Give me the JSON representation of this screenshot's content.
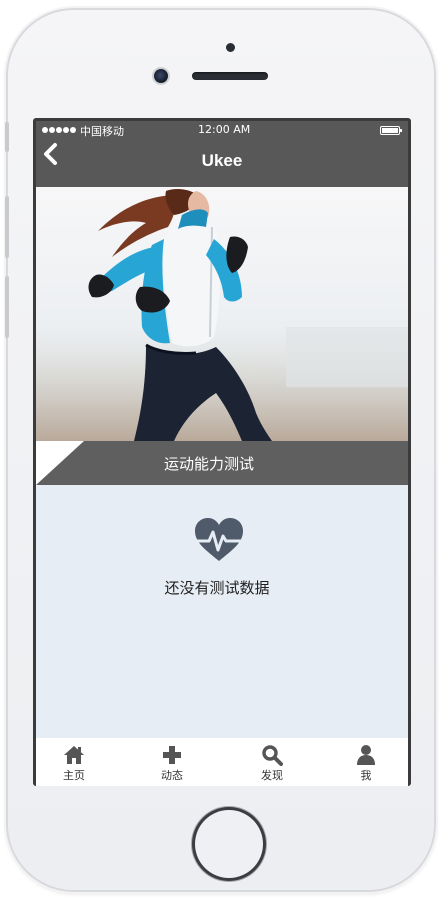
{
  "status_bar": {
    "carrier": "中国移动",
    "time": "12:00 AM"
  },
  "header": {
    "back_icon": "chevron-left-icon",
    "title": "Ukee"
  },
  "hero": {
    "image": "woman-running-photo"
  },
  "section": {
    "title": "运动能力测试"
  },
  "empty_state": {
    "icon": "heart-pulse-icon",
    "message": "还没有测试数据"
  },
  "tabbar": {
    "items": [
      {
        "label": "主页",
        "icon": "home-icon"
      },
      {
        "label": "动态",
        "icon": "plus-icon"
      },
      {
        "label": "发现",
        "icon": "search-icon"
      },
      {
        "label": "我",
        "icon": "user-icon"
      }
    ]
  },
  "colors": {
    "header_bg": "#585858",
    "section_bar_bg": "#5f5f5f",
    "content_bg": "#e6edf5",
    "icon_color": "#4f5a6a"
  }
}
